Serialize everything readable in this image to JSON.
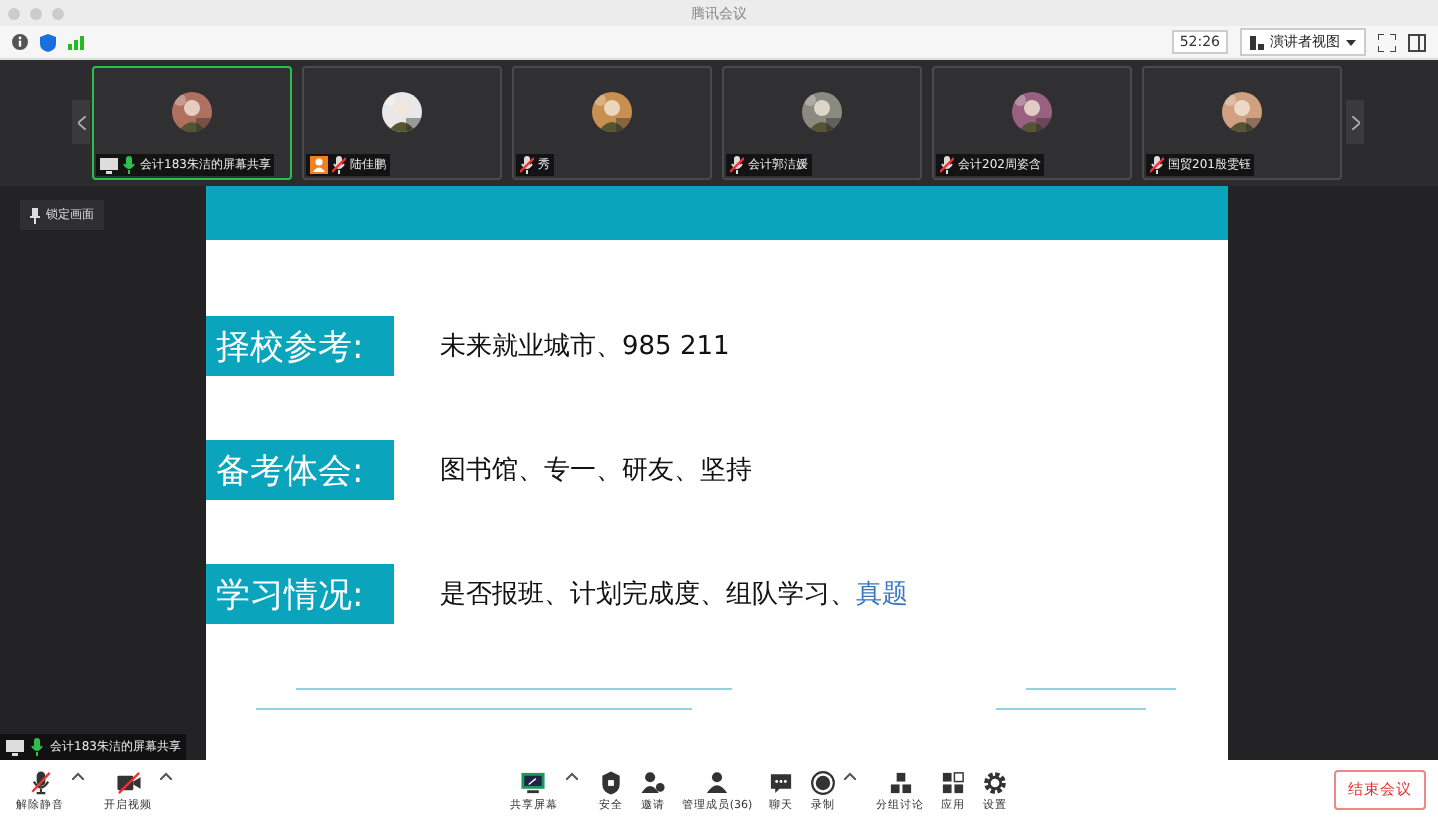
{
  "window": {
    "title": "腾讯会议"
  },
  "toolbar": {
    "timer": "52:26",
    "view_button": "演讲者视图"
  },
  "participants": [
    {
      "name": "会计183朱洁的屏幕共享",
      "kind": "sharer",
      "muted": false,
      "selected": true
    },
    {
      "name": "陆佳鹏",
      "kind": "host",
      "muted": true,
      "selected": false
    },
    {
      "name": "秀",
      "kind": "guest",
      "muted": true,
      "selected": false
    },
    {
      "name": "会计郭洁媛",
      "kind": "guest",
      "muted": true,
      "selected": false
    },
    {
      "name": "会计202周姿含",
      "kind": "guest",
      "muted": true,
      "selected": false
    },
    {
      "name": "国贸201殷雯钰",
      "kind": "guest",
      "muted": true,
      "selected": false
    }
  ],
  "lock_button": "锁定画面",
  "slide": {
    "rows": [
      {
        "label": "择校参考:",
        "value": "未来就业城市、985 211"
      },
      {
        "label": "备考体会:",
        "value": "图书馆、专一、研友、坚持"
      },
      {
        "label": "学习情况:",
        "value": "是否报班、计划完成度、组队学习、",
        "highlight": "真题"
      }
    ]
  },
  "share_label": "会计183朱洁的屏幕共享",
  "controls": [
    {
      "label": "解除静音",
      "kind": "mic",
      "caret": true
    },
    {
      "label": "开启视频",
      "kind": "camera",
      "caret": true
    },
    {
      "label": "共享屏幕",
      "kind": "share",
      "caret": true
    },
    {
      "label": "安全",
      "kind": "security",
      "caret": false
    },
    {
      "label": "邀请",
      "kind": "invite",
      "caret": false
    },
    {
      "label": "管理成员(36)",
      "kind": "members",
      "caret": false
    },
    {
      "label": "聊天",
      "kind": "chat",
      "caret": false
    },
    {
      "label": "录制",
      "kind": "record",
      "caret": true
    },
    {
      "label": "分组讨论",
      "kind": "groups",
      "caret": false
    },
    {
      "label": "应用",
      "kind": "apps",
      "caret": false
    },
    {
      "label": "设置",
      "kind": "settings",
      "caret": false
    }
  ],
  "end_button": "结束会议"
}
